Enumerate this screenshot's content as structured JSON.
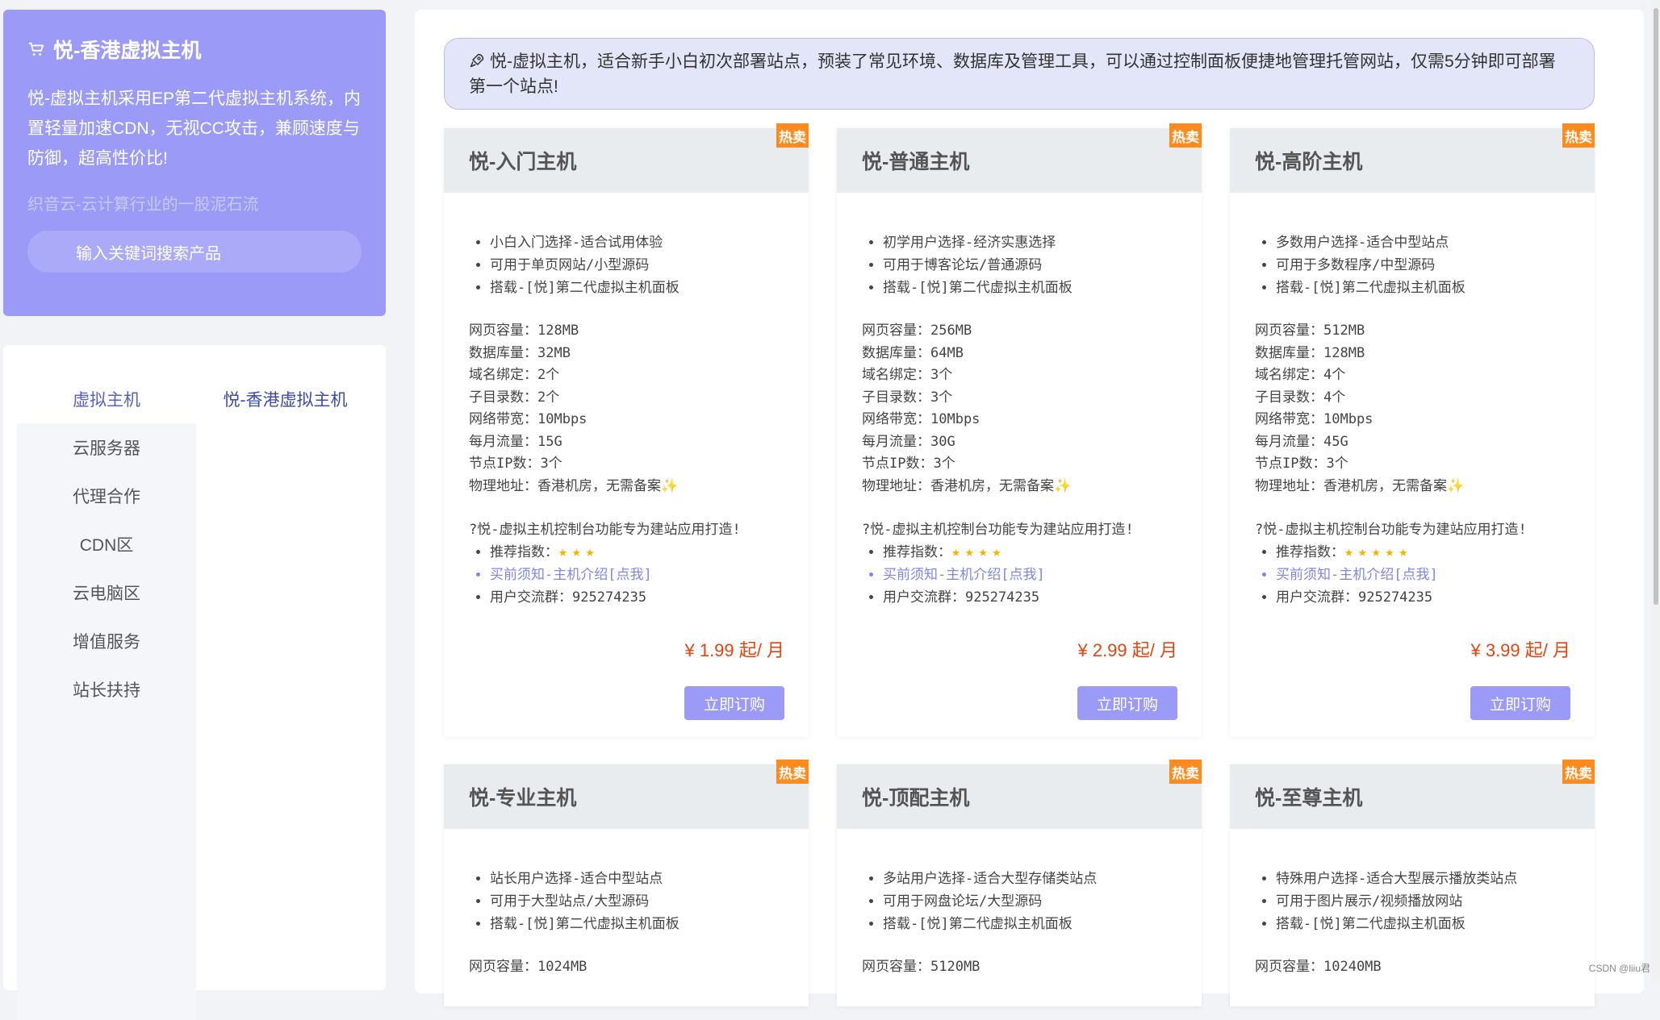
{
  "hero": {
    "title": "悦-香港虚拟主机",
    "desc": "悦-虚拟主机采用EP第二代虚拟主机系统，内置轻量加速CDN，无视CC攻击，兼顾速度与防御，超高性价比!",
    "slogan": "织音云-云计算行业的一股泥石流",
    "search_placeholder": "输入关键词搜索产品"
  },
  "nav": {
    "items": [
      "虚拟主机",
      "云服务器",
      "代理合作",
      "CDN区",
      "云电脑区",
      "增值服务",
      "站长扶持"
    ],
    "active_sub": "悦-香港虚拟主机"
  },
  "notice": "悦-虚拟主机，适合新手小白初次部署站点，预装了常见环境、数据库及管理工具，可以通过控制面板便捷地管理托管网站，仅需5分钟即可部署第一个站点!",
  "labels": {
    "badge": "热卖",
    "order": "立即订购",
    "web_space": "网页容量：",
    "db_space": "数据库量：",
    "domains": "域名绑定：",
    "subdirs": "子目录数：",
    "bandwidth": "网络带宽：",
    "traffic": "每月流量：",
    "ip_count": "节点IP数：",
    "location": "物理地址：",
    "note": "?悦-虚拟主机控制台功能专为建站应用打造!",
    "recommend": "推荐指数：",
    "buy_notice": "买前须知-主机介绍[点我]",
    "group": "用户交流群：925274235"
  },
  "cards": [
    {
      "name": "悦-入门主机",
      "features": [
        "小白入门选择-适合试用体验",
        "可用于单页网站/小型源码",
        "搭载-[悦]第二代虚拟主机面板"
      ],
      "web_space": "128MB",
      "db_space": "32MB",
      "domains": "2个",
      "subdirs": "2个",
      "bandwidth": "10Mbps",
      "traffic": "15G",
      "ip_count": "3个",
      "location": "香港机房，无需备案✨",
      "stars": "★★★",
      "price": "¥ 1.99 起/ 月"
    },
    {
      "name": "悦-普通主机",
      "features": [
        "初学用户选择-经济实惠选择",
        "可用于博客论坛/普通源码",
        "搭载-[悦]第二代虚拟主机面板"
      ],
      "web_space": "256MB",
      "db_space": "64MB",
      "domains": "3个",
      "subdirs": "3个",
      "bandwidth": "10Mbps",
      "traffic": "30G",
      "ip_count": "3个",
      "location": "香港机房，无需备案✨",
      "stars": "★★★★",
      "price": "¥ 2.99 起/ 月"
    },
    {
      "name": "悦-高阶主机",
      "features": [
        "多数用户选择-适合中型站点",
        "可用于多数程序/中型源码",
        "搭载-[悦]第二代虚拟主机面板"
      ],
      "web_space": "512MB",
      "db_space": "128MB",
      "domains": "4个",
      "subdirs": "4个",
      "bandwidth": "10Mbps",
      "traffic": "45G",
      "ip_count": "3个",
      "location": "香港机房，无需备案✨",
      "stars": "★★★★★",
      "price": "¥ 3.99 起/ 月"
    },
    {
      "name": "悦-专业主机",
      "features": [
        "站长用户选择-适合中型站点",
        "可用于大型站点/大型源码",
        "搭载-[悦]第二代虚拟主机面板"
      ],
      "web_space": "1024MB"
    },
    {
      "name": "悦-顶配主机",
      "features": [
        "多站用户选择-适合大型存储类站点",
        "可用于网盘论坛/大型源码",
        "搭载-[悦]第二代虚拟主机面板"
      ],
      "web_space": "5120MB"
    },
    {
      "name": "悦-至尊主机",
      "features": [
        "特殊用户选择-适合大型展示播放类站点",
        "可用于图片展示/视频播放网站",
        "搭载-[悦]第二代虚拟主机面板"
      ],
      "web_space": "10240MB"
    }
  ],
  "watermark": "CSDN @liiu君",
  "colors": {
    "accent": "#9b9bf7",
    "price": "#e8430c",
    "badge": "#ff8a1e",
    "link": "#7f86e6"
  }
}
